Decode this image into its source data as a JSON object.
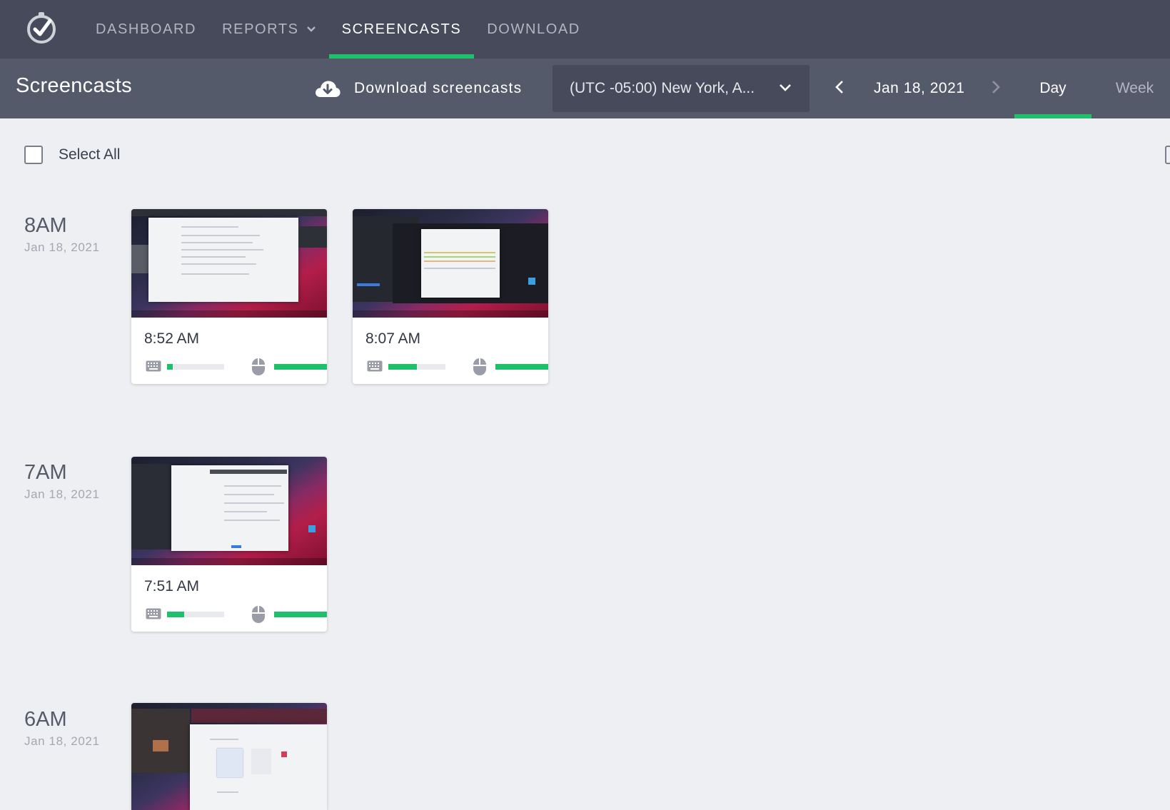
{
  "nav": {
    "items": [
      {
        "label": "DASHBOARD"
      },
      {
        "label": "REPORTS",
        "has_dropdown": true
      },
      {
        "label": "SCREENCASTS",
        "active": true
      },
      {
        "label": "DOWNLOAD"
      }
    ]
  },
  "toolbar": {
    "title": "Screencasts",
    "download_label": "Download screencasts",
    "timezone": "(UTC -05:00) New York, A...",
    "date": "Jan 18, 2021",
    "periods": [
      {
        "label": "Day",
        "active": true
      },
      {
        "label": "Week"
      }
    ]
  },
  "select_all_label": "Select All",
  "hours": [
    {
      "hour": "8AM",
      "date": "Jan 18, 2021"
    },
    {
      "hour": "7AM",
      "date": "Jan 18, 2021"
    },
    {
      "hour": "6AM",
      "date": "Jan 18, 2021"
    }
  ],
  "screencasts": [
    {
      "time": "8:52 AM",
      "keyboard_activity": 0.1,
      "mouse_activity": 1.0
    },
    {
      "time": "8:07 AM",
      "keyboard_activity": 0.5,
      "mouse_activity": 1.0
    },
    {
      "time": "7:51 AM",
      "keyboard_activity": 0.3,
      "mouse_activity": 1.0
    }
  ],
  "colors": {
    "topbar": "#464a5a",
    "subbar": "#555a6b",
    "accent": "#20c06b",
    "background": "#eeeff3"
  }
}
